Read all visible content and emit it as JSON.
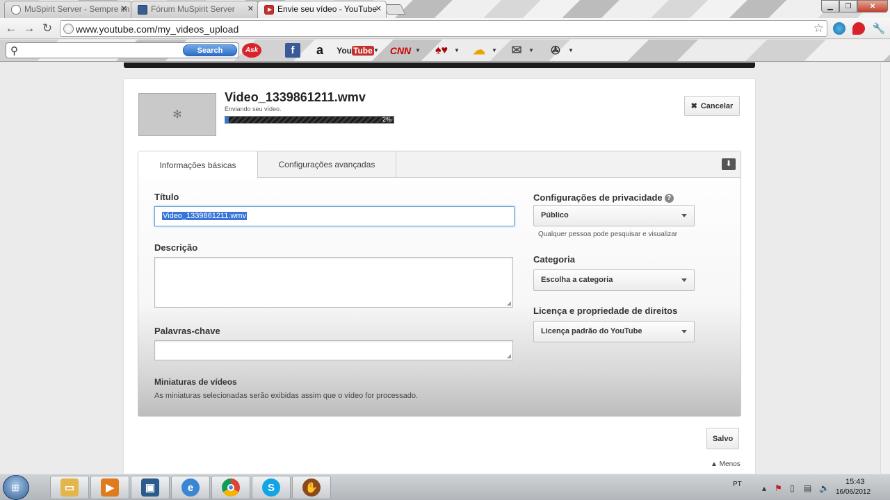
{
  "browser": {
    "tabs": [
      {
        "title": "MuSpirit Server - Sempre im",
        "icon": "globe-icon"
      },
      {
        "title": "Fórum MuSpirit Server",
        "icon": "forum-icon"
      },
      {
        "title": "Envie seu vídeo - YouTube",
        "icon": "youtube-icon"
      }
    ],
    "url": "www.youtube.com/my_videos_upload"
  },
  "ask_toolbar": {
    "search_placeholder": "",
    "search_button": "Search",
    "buttons": [
      "Ask",
      "Facebook",
      "Amazon",
      "YouTube",
      "CNN",
      "Games",
      "Weather",
      "Mail",
      "Options"
    ],
    "youtube_label": "You",
    "youtube_tube": "Tube",
    "cnn_label": "CNN",
    "ask_label": "Ask"
  },
  "upload": {
    "file_name": "Video_1339861211.wmv",
    "status": "Enviando seu vídeo.",
    "progress_percent": 2,
    "progress_label": "2%",
    "cancel_label": "Cancelar"
  },
  "form": {
    "tabs": [
      "Informações básicas",
      "Configurações avançadas"
    ],
    "title_label": "Título",
    "title_value": "Video_1339861211.wmv",
    "description_label": "Descrição",
    "keywords_label": "Palavras-chave",
    "thumbnails_label": "Miniaturas de vídeos",
    "thumbnails_note": "As miniaturas selecionadas serão exibidas assim que o vídeo for processado.",
    "privacy_label": "Configurações de privacidade",
    "privacy_value": "Público",
    "privacy_note": "Qualquer pessoa pode pesquisar e visualizar",
    "category_label": "Categoria",
    "category_value": "Escolha a categoria",
    "license_label": "Licença e propriedade de direitos",
    "license_value": "Licença padrão do YouTube",
    "save_label": "Salvo",
    "less_label": "▲ Menos"
  },
  "taskbar": {
    "language": "PT",
    "time": "15:43",
    "date": "16/06/2012"
  },
  "colors": {
    "accent": "#2e77d6",
    "selection": "#3875d7",
    "close_red": "#c0412d"
  }
}
